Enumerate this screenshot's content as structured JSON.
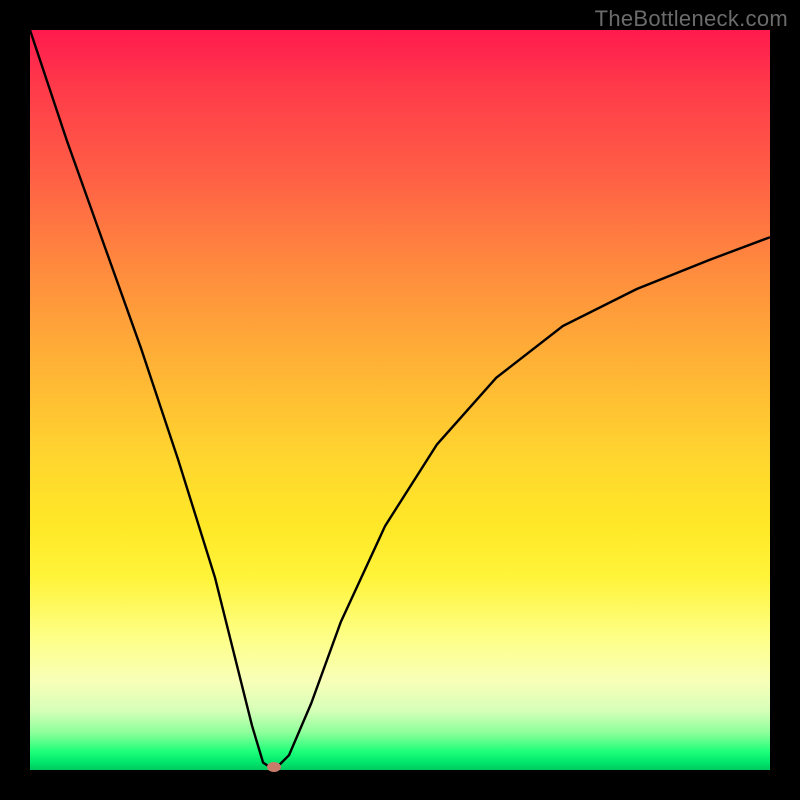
{
  "watermark": "TheBottleneck.com",
  "chart_data": {
    "type": "line",
    "title": "",
    "xlabel": "",
    "ylabel": "",
    "ylim": [
      0,
      100
    ],
    "xlim": [
      0,
      100
    ],
    "series": [
      {
        "name": "bottleneck-curve",
        "x": [
          0,
          5,
          10,
          15,
          20,
          25,
          28,
          30,
          31.5,
          33,
          35,
          38,
          42,
          48,
          55,
          63,
          72,
          82,
          92,
          100
        ],
        "values": [
          100,
          85,
          71,
          57,
          42,
          26,
          14,
          6,
          1,
          0,
          2,
          9,
          20,
          33,
          44,
          53,
          60,
          65,
          69,
          72
        ]
      }
    ],
    "marker": {
      "x": 33,
      "y": 0
    },
    "gradient_stops": [
      {
        "pct": 0,
        "color": "#ff1a4d"
      },
      {
        "pct": 45,
        "color": "#ffb236"
      },
      {
        "pct": 74,
        "color": "#fff43a"
      },
      {
        "pct": 100,
        "color": "#00c95e"
      }
    ]
  }
}
